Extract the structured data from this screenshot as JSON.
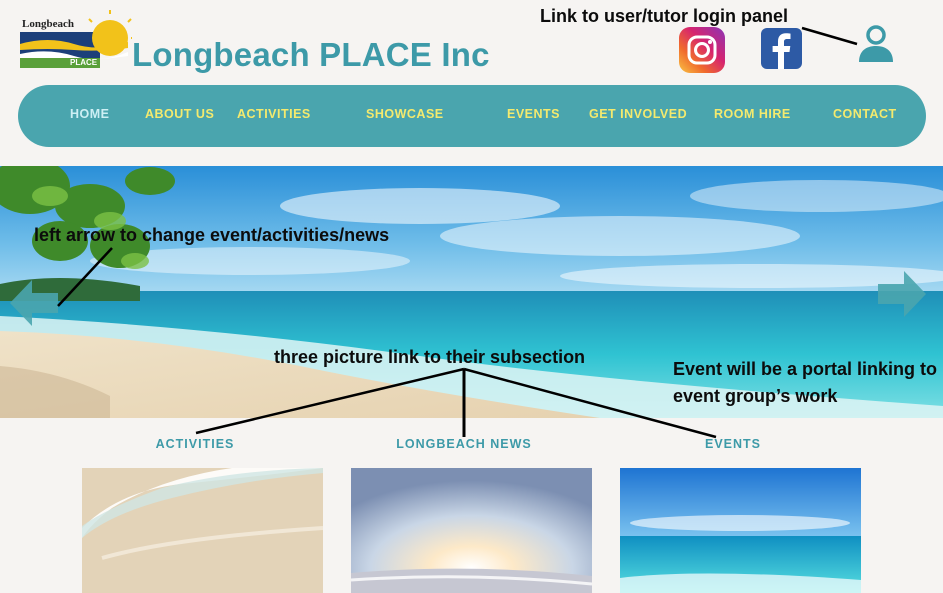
{
  "header": {
    "logo_text_top": "Longbeach",
    "logo_text_bottom": "PLACE",
    "title": "Longbeach PLACE Inc"
  },
  "social": {
    "instagram_icon": "instagram-icon",
    "facebook_icon": "facebook-icon",
    "user_icon": "user-icon"
  },
  "nav": {
    "items": [
      {
        "label": "HOME"
      },
      {
        "label": "ABOUT US"
      },
      {
        "label": "ACTIVITIES"
      },
      {
        "label": "SHOWCASE"
      },
      {
        "label": "EVENTS"
      },
      {
        "label": "GET INVOLVED"
      },
      {
        "label": "ROOM HIRE"
      },
      {
        "label": "CONTACT"
      }
    ]
  },
  "annotations": {
    "login": "Link to user/tutor login panel",
    "left_arrow": "left arrow to change event/activities/news",
    "three_pictures": "three picture link to their subsection",
    "event_portal_line1": "Event will be a portal linking to",
    "event_portal_line2": "event group’s work"
  },
  "sections": [
    {
      "label": "ACTIVITIES"
    },
    {
      "label": "LONGBEACH NEWS"
    },
    {
      "label": "EVENTS"
    }
  ],
  "colors": {
    "brand_teal": "#3d9aa8",
    "nav_bg": "#4aa5ae",
    "nav_text": "#f4ea6e",
    "nav_active": "#cdeff4"
  }
}
